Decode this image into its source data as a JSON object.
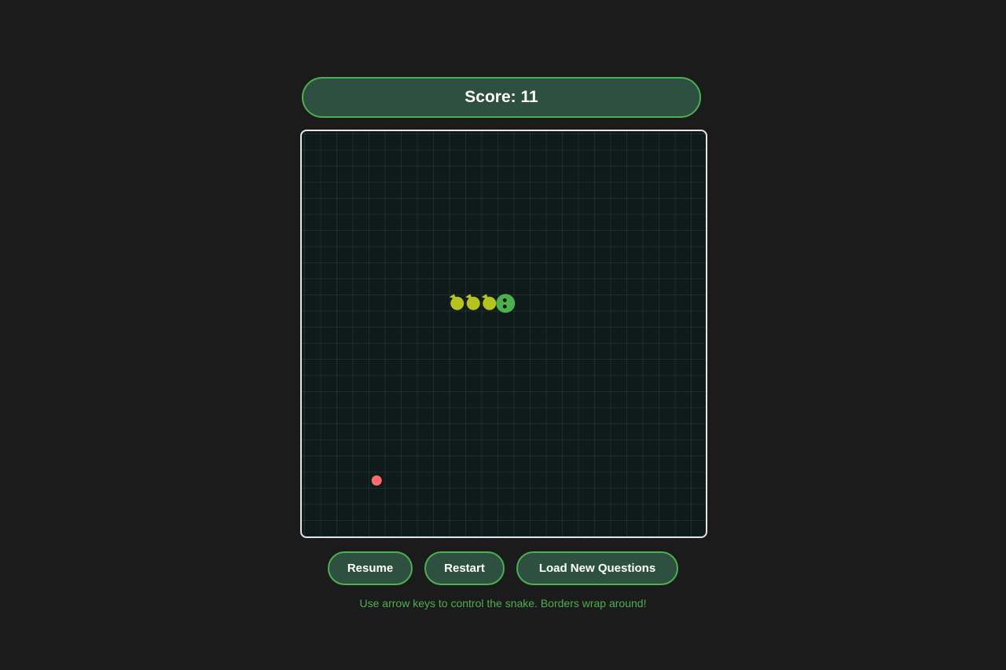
{
  "score": {
    "text": "Score: 11"
  },
  "board": {
    "grid_cells": 25,
    "colors": {
      "background": "#0f1b1b",
      "grid_line": "#2b3f3b",
      "snake_head": "#4caf50",
      "snake_body": "#b5c41c",
      "food": "#ff6b6b"
    },
    "snake": [
      {
        "col": 12,
        "row": 10,
        "part": "head"
      },
      {
        "col": 11,
        "row": 10,
        "part": "body"
      },
      {
        "col": 10,
        "row": 10,
        "part": "body"
      },
      {
        "col": 9,
        "row": 10,
        "part": "body"
      }
    ],
    "food": {
      "col": 4,
      "row": 21
    }
  },
  "controls": {
    "resume_label": "Resume",
    "restart_label": "Restart",
    "load_label": "Load New Questions"
  },
  "hint": "Use arrow keys to control the snake. Borders wrap around!"
}
